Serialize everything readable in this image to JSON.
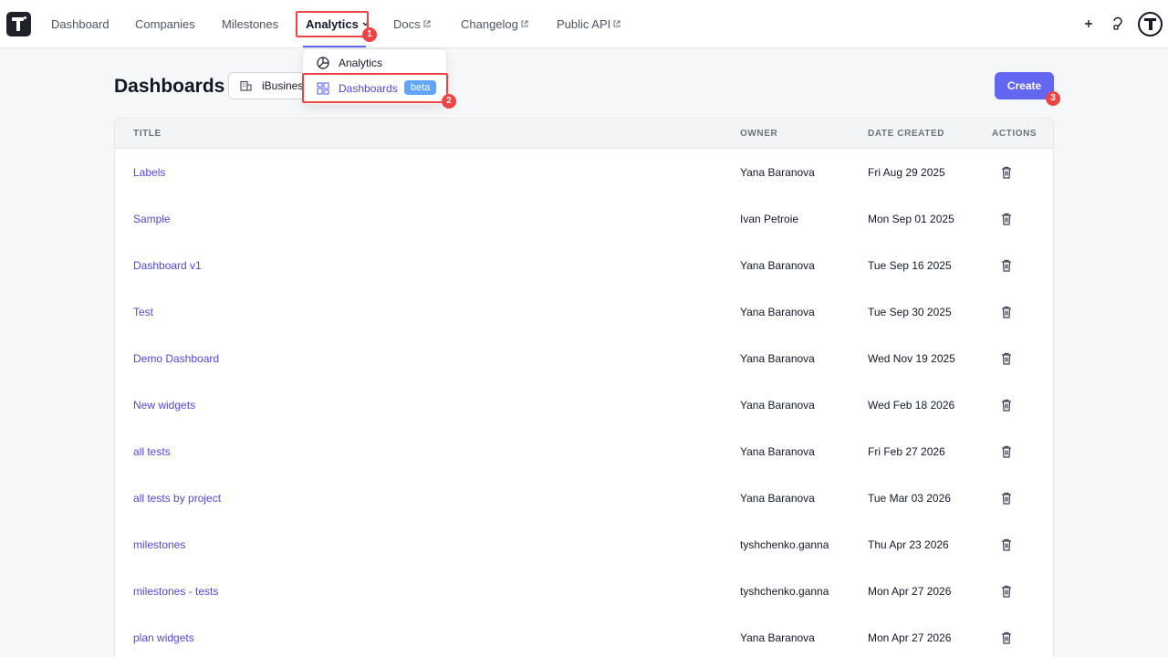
{
  "nav": {
    "items": [
      {
        "label": "Dashboard"
      },
      {
        "label": "Companies"
      },
      {
        "label": "Milestones"
      },
      {
        "label": "Analytics"
      },
      {
        "label": "Docs"
      },
      {
        "label": "Changelog"
      },
      {
        "label": "Public API"
      }
    ]
  },
  "dropdown": {
    "items": [
      {
        "label": "Analytics"
      },
      {
        "label": "Dashboards",
        "badge": "beta"
      }
    ]
  },
  "annotations": [
    "1",
    "2",
    "3"
  ],
  "page": {
    "title": "Dashboards",
    "project": "iBusiness",
    "create_label": "Create"
  },
  "table": {
    "headers": {
      "title": "TITLE",
      "owner": "OWNER",
      "date": "DATE CREATED",
      "actions": "ACTIONS"
    },
    "rows": [
      {
        "title": "Labels",
        "owner": "Yana Baranova",
        "date": "Fri Aug 29 2025"
      },
      {
        "title": "Sample",
        "owner": "Ivan Petroie",
        "date": "Mon Sep 01 2025"
      },
      {
        "title": "Dashboard v1",
        "owner": "Yana Baranova",
        "date": "Tue Sep 16 2025"
      },
      {
        "title": "Test",
        "owner": "Yana Baranova",
        "date": "Tue Sep 30 2025"
      },
      {
        "title": "Demo Dashboard",
        "owner": "Yana Baranova",
        "date": "Wed Nov 19 2025"
      },
      {
        "title": "New widgets",
        "owner": "Yana Baranova",
        "date": "Wed Feb 18 2026"
      },
      {
        "title": "all tests",
        "owner": "Yana Baranova",
        "date": "Fri Feb 27 2026"
      },
      {
        "title": "all tests by project",
        "owner": "Yana Baranova",
        "date": "Tue Mar 03 2026"
      },
      {
        "title": "milestones",
        "owner": "tyshchenko.ganna",
        "date": "Thu Apr 23 2026"
      },
      {
        "title": "milestones - tests",
        "owner": "tyshchenko.ganna",
        "date": "Mon Apr 27 2026"
      },
      {
        "title": "plan widgets",
        "owner": "Yana Baranova",
        "date": "Mon Apr 27 2026"
      }
    ]
  },
  "colors": {
    "accent": "#6366f1",
    "link": "#4f46e5",
    "annotation": "#ef4444",
    "beta": "#60a5fa"
  }
}
